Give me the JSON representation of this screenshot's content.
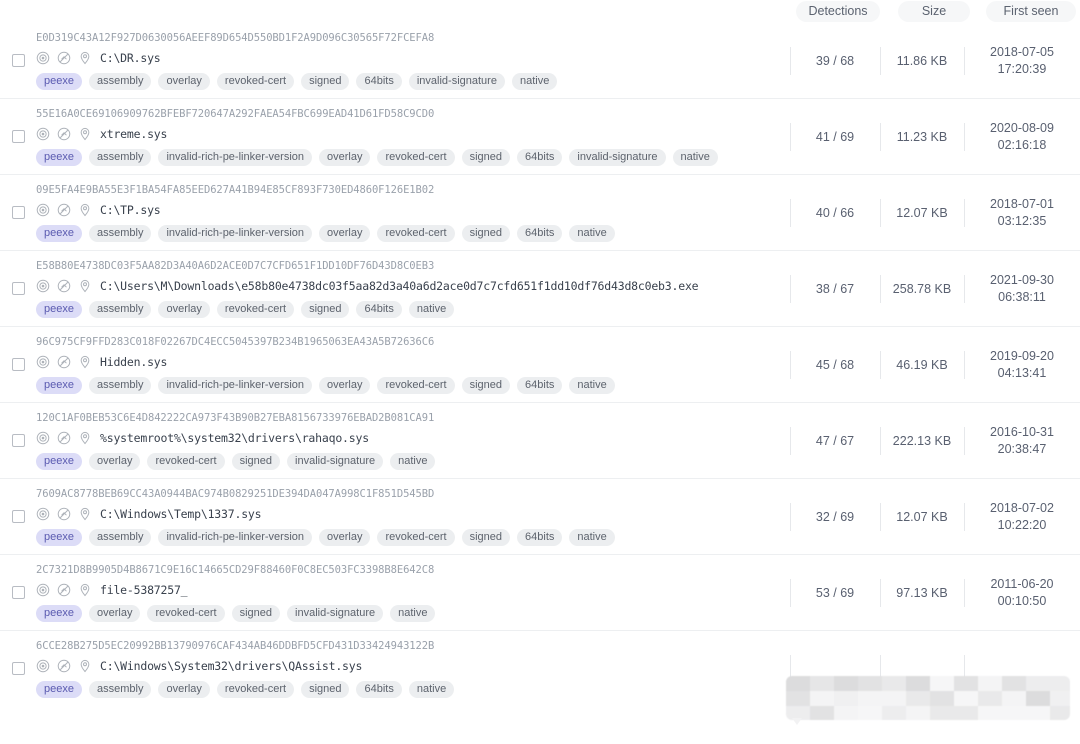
{
  "table": {
    "columns": [
      {
        "key": "detections",
        "label": "Detections"
      },
      {
        "key": "size",
        "label": "Size"
      },
      {
        "key": "first_seen",
        "label": "First seen"
      }
    ],
    "colors": {
      "tag_default_bg": "#eceef0",
      "tag_default_text": "#5d636d",
      "tag_accent_bg": "#dcdcf7",
      "tag_accent_text": "#5a5ab0",
      "header_pill_bg": "#f6f7f8",
      "hash_text": "#9aa1ab",
      "row_divider": "#edeff1"
    },
    "rows": [
      {
        "hash": "E0D319C43A12F927D0630056AEEF89D654D550BD1F2A9D096C30565F72FCEFA8",
        "filename": "C:\\DR.sys",
        "tags": [
          "peexe",
          "assembly",
          "overlay",
          "revoked-cert",
          "signed",
          "64bits",
          "invalid-signature",
          "native"
        ],
        "detections": "39 / 68",
        "size": "11.86 KB",
        "first_seen_date": "2018-07-05",
        "first_seen_time": "17:20:39"
      },
      {
        "hash": "55E16A0CE69106909762BFEBF720647A292FAEA54FBC699EAD41D61FD58C9CD0",
        "filename": "xtreme.sys",
        "tags": [
          "peexe",
          "assembly",
          "invalid-rich-pe-linker-version",
          "overlay",
          "revoked-cert",
          "signed",
          "64bits",
          "invalid-signature",
          "native"
        ],
        "detections": "41 / 69",
        "size": "11.23 KB",
        "first_seen_date": "2020-08-09",
        "first_seen_time": "02:16:18"
      },
      {
        "hash": "09E5FA4E9BA55E3F1BA54FA85EED627A41B94E85CF893F730ED4860F126E1B02",
        "filename": "C:\\TP.sys",
        "tags": [
          "peexe",
          "assembly",
          "invalid-rich-pe-linker-version",
          "overlay",
          "revoked-cert",
          "signed",
          "64bits",
          "native"
        ],
        "detections": "40 / 66",
        "size": "12.07 KB",
        "first_seen_date": "2018-07-01",
        "first_seen_time": "03:12:35"
      },
      {
        "hash": "E58B80E4738DC03F5AA82D3A40A6D2ACE0D7C7CFD651F1DD10DF76D43D8C0EB3",
        "filename": "C:\\Users\\M\\Downloads\\e58b80e4738dc03f5aa82d3a40a6d2ace0d7c7cfd651f1dd10df76d43d8c0eb3.exe",
        "tags": [
          "peexe",
          "assembly",
          "overlay",
          "revoked-cert",
          "signed",
          "64bits",
          "native"
        ],
        "detections": "38 / 67",
        "size": "258.78 KB",
        "first_seen_date": "2021-09-30",
        "first_seen_time": "06:38:11"
      },
      {
        "hash": "96C975CF9FFD283C018F02267DC4ECC5045397B234B1965063EA43A5B72636C6",
        "filename": "Hidden.sys",
        "tags": [
          "peexe",
          "assembly",
          "invalid-rich-pe-linker-version",
          "overlay",
          "revoked-cert",
          "signed",
          "64bits",
          "native"
        ],
        "detections": "45 / 68",
        "size": "46.19 KB",
        "first_seen_date": "2019-09-20",
        "first_seen_time": "04:13:41"
      },
      {
        "hash": "120C1AF0BEB53C6E4D842222CA973F43B90B27EBA8156733976EBAD2B081CA91",
        "filename": "%systemroot%\\system32\\drivers\\rahaqo.sys",
        "tags": [
          "peexe",
          "overlay",
          "revoked-cert",
          "signed",
          "invalid-signature",
          "native"
        ],
        "detections": "47 / 67",
        "size": "222.13 KB",
        "first_seen_date": "2016-10-31",
        "first_seen_time": "20:38:47"
      },
      {
        "hash": "7609AC8778BEB69CC43A0944BAC974B0829251DE394DA047A998C1F851D545BD",
        "filename": "C:\\Windows\\Temp\\1337.sys",
        "tags": [
          "peexe",
          "assembly",
          "invalid-rich-pe-linker-version",
          "overlay",
          "revoked-cert",
          "signed",
          "64bits",
          "native"
        ],
        "detections": "32 / 69",
        "size": "12.07 KB",
        "first_seen_date": "2018-07-02",
        "first_seen_time": "10:22:20"
      },
      {
        "hash": "2C7321D8B9905D4B8671C9E16C14665CD29F88460F0C8EC503FC3398B8E642C8",
        "filename": "file-5387257_",
        "tags": [
          "peexe",
          "overlay",
          "revoked-cert",
          "signed",
          "invalid-signature",
          "native"
        ],
        "detections": "53 / 69",
        "size": "97.13 KB",
        "first_seen_date": "2011-06-20",
        "first_seen_time": "00:10:50"
      },
      {
        "hash": "6CCE28B275D5EC20992BB13790976CAF434AB46DDBFD5CFD431D33424943122B",
        "filename": "C:\\Windows\\System32\\drivers\\QAssist.sys",
        "tags": [
          "peexe",
          "assembly",
          "overlay",
          "revoked-cert",
          "signed",
          "64bits",
          "native"
        ],
        "detections": "",
        "size": "",
        "first_seen_date": "",
        "first_seen_time": ""
      }
    ],
    "row_icons": [
      "target-icon",
      "no-entry-icon",
      "location-pin-icon"
    ],
    "select_row_checkbox": "row-select-checkbox"
  }
}
